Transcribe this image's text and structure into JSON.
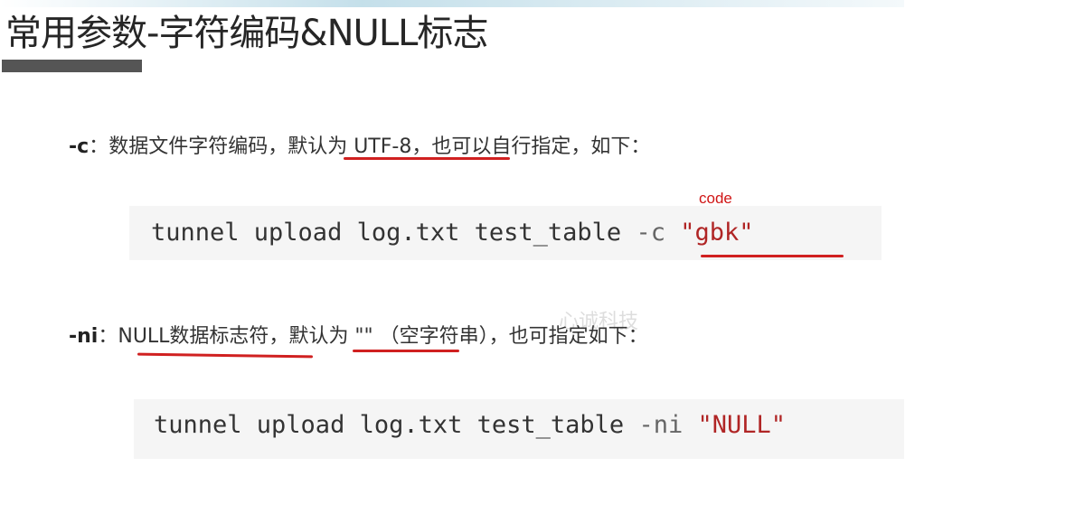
{
  "slide": {
    "title": "常用参数-字符编码&NULL标志"
  },
  "param_c": {
    "flag": "-c",
    "sep": "：",
    "desc_pre": "数据文件字符编码，",
    "desc_highlight": "默认为 UTF-8，",
    "desc_post": "也可以自行指定，如下："
  },
  "code_c": {
    "command": "tunnel upload log.txt test_table ",
    "option": "-c",
    "space": " ",
    "value": "\"gbk\""
  },
  "annotation": {
    "code_label": "code"
  },
  "param_ni": {
    "flag": "-ni",
    "sep": "：",
    "desc_highlight1": "NULL数据标志符，",
    "desc_highlight2": "默认为 \"\"",
    "desc_post": " （空字符串），也可指定如下："
  },
  "code_ni": {
    "command": "tunnel upload log.txt test_table ",
    "option": "-ni",
    "space": " ",
    "value": "\"NULL\""
  },
  "watermark": {
    "text": "心诚科技"
  },
  "colors": {
    "annotation_red": "#d02020",
    "code_bg": "#f5f5f5",
    "title_bar": "#555555"
  }
}
